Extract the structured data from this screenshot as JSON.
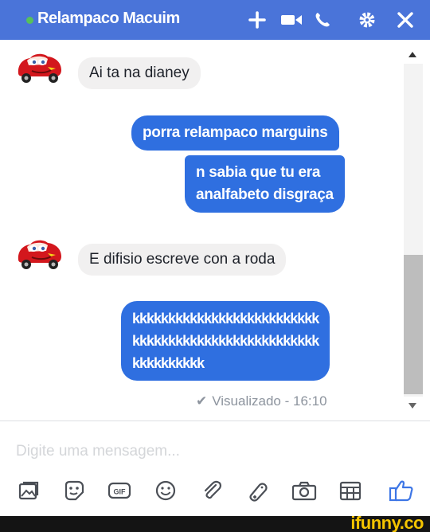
{
  "header": {
    "status_color": "#57c15b",
    "title": "Relampaco Macuim",
    "background": "#4a74d9",
    "icons": [
      "add-people-icon",
      "video-call-icon",
      "phone-icon",
      "settings-icon",
      "close-icon"
    ]
  },
  "messages": [
    {
      "direction": "incoming",
      "text": "Ai ta na dianey",
      "avatar": "lightning-mcqueen-avatar"
    },
    {
      "direction": "outgoing",
      "text": "porra relampaco marguins"
    },
    {
      "direction": "outgoing",
      "lines": [
        "n sabia que tu era",
        "analfabeto disgraça"
      ]
    },
    {
      "direction": "incoming",
      "text": "E difisio escreve con a roda",
      "avatar": "lightning-mcqueen-avatar"
    },
    {
      "direction": "outgoing",
      "lines": [
        "kkkkkkkkkkkkkkkkkkkkkkkkkk",
        "kkkkkkkkkkkkkkkkkkkkkkkkkk",
        "kkkkkkkkkk"
      ]
    }
  ],
  "seen": {
    "check": "✔",
    "label": "Visualizado - 16:10"
  },
  "composer": {
    "placeholder": "Digite uma mensagem..."
  },
  "toolbar": {
    "icons": [
      "photo-icon",
      "sticker-icon",
      "gif-icon",
      "emoji-icon",
      "attach-icon",
      "game-icon",
      "camera-icon",
      "calendar-icon",
      "like-icon"
    ]
  },
  "colors": {
    "outgoing_bubble": "#2f6fe0",
    "incoming_bubble": "#f1f0f0",
    "accent": "#4a74d9"
  },
  "watermark": "ifunny.co"
}
